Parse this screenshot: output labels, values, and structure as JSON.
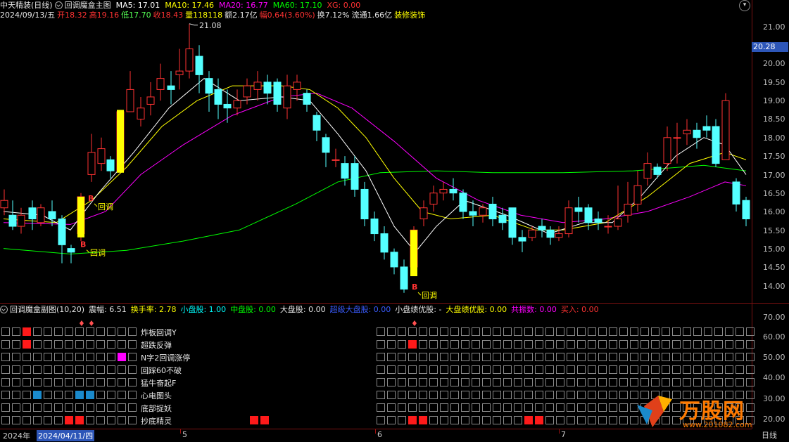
{
  "header": {
    "stock_name": "中天精装(日线)",
    "chart_name": "回调魔盒主图",
    "ma5": "MA5: 17.01",
    "ma10": "MA10: 17.46",
    "ma20": "MA20: 16.77",
    "ma60": "MA60: 17.10",
    "xg": "XG: 0.00",
    "date": "2024/09/13/五",
    "open": "开18.32",
    "high": "高19.16",
    "low": "低17.70",
    "close": "收18.43",
    "volume": "量118118",
    "amount": "额2.17亿",
    "change": "幅0.64(3.60%)",
    "turnover": "换7.12%",
    "float": "流通1.66亿",
    "sector": "装修装饰"
  },
  "price_axis": {
    "ticks": [
      "21.00",
      "20.50",
      "20.00",
      "19.50",
      "19.00",
      "18.50",
      "18.00",
      "17.50",
      "17.00",
      "16.50",
      "16.00",
      "15.50",
      "15.00",
      "14.50",
      "14.00"
    ],
    "current_price": "20.28"
  },
  "annotations": {
    "peak_label": "21.08",
    "pullback_labels": [
      "回调",
      "回调",
      "回调"
    ],
    "b_marks": [
      "B",
      "B",
      "B"
    ]
  },
  "indicator": {
    "title": "回调魔盒副图(10,20)",
    "amplitude": "震幅: 6.51",
    "turnover": "换手率: 2.78",
    "small_cap": "小盘股: 1.00",
    "mid_cap": "中盘股: 0.00",
    "large_cap": "大盘股: 0.00",
    "super_large": "超级大盘股: 0.00",
    "small_perf": "小盘绩优股: -",
    "large_perf": "大盘绩优股: 0.00",
    "co_vibration": "共振数: 0.00",
    "buy": "买入: 0.00",
    "rows": [
      "炸板回调Y",
      "超跌反弹",
      "N字2回调涨停",
      "回踩60不破",
      "猛牛奋起F",
      "心电图头",
      "底部捉妖",
      "抄底精灵"
    ],
    "axis_ticks": [
      "70.00",
      "60.00",
      "50.00",
      "40.00",
      "30.00",
      "20.00"
    ]
  },
  "timeline": {
    "labels": [
      "2024年",
      "2024/04/11/四",
      "5",
      "6",
      "7"
    ],
    "period": "日线"
  },
  "colors": {
    "up": "#ff3232",
    "down": "#54ffff",
    "ma5": "#ffffff",
    "ma10": "#ffff00",
    "ma20": "#ff00ff",
    "ma60": "#00ff00",
    "signal": "#ffff00"
  },
  "logo": {
    "text": "万股网",
    "sub": "www.201082.com"
  }
}
